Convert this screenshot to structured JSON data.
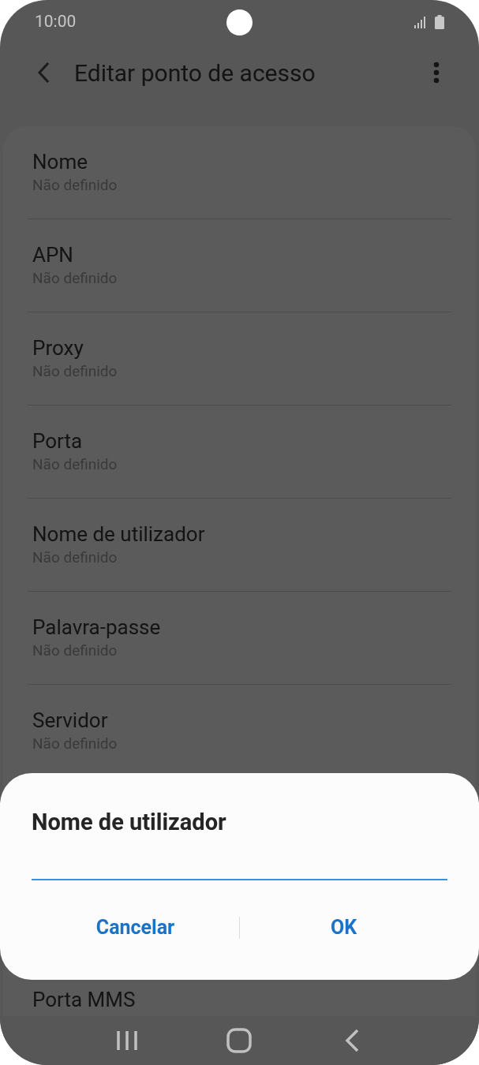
{
  "status_bar": {
    "time": "10:00"
  },
  "app_bar": {
    "title": "Editar ponto de acesso"
  },
  "list": {
    "items": [
      {
        "title": "Nome",
        "value": "Não definido"
      },
      {
        "title": "APN",
        "value": "Não definido"
      },
      {
        "title": "Proxy",
        "value": "Não definido"
      },
      {
        "title": "Porta",
        "value": "Não definido"
      },
      {
        "title": "Nome de utilizador",
        "value": "Não definido"
      },
      {
        "title": "Palavra-passe",
        "value": "Não definido"
      },
      {
        "title": "Servidor",
        "value": "Não definido"
      }
    ],
    "partial_item": {
      "title": "Porta MMS"
    }
  },
  "dialog": {
    "title": "Nome de utilizador",
    "buttons": [
      "Cancelar",
      "OK"
    ]
  }
}
